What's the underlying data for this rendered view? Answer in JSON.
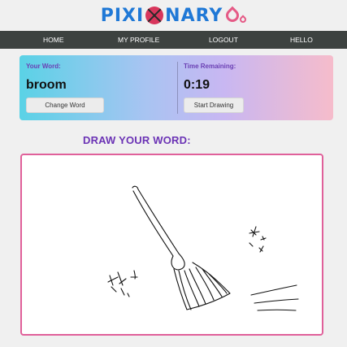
{
  "brand": {
    "name_left": "PIXI",
    "name_right": "NARY"
  },
  "nav": {
    "items": [
      {
        "label": "HOME"
      },
      {
        "label": "MY PROFILE"
      },
      {
        "label": "LOGOUT"
      },
      {
        "label": "HELLO"
      }
    ]
  },
  "word_panel": {
    "word_label": "Your Word:",
    "word": "broom",
    "change_button": "Change Word",
    "time_label": "Time Remaining:",
    "time": "0:19",
    "start_button": "Start Drawing"
  },
  "canvas": {
    "heading": "DRAW YOUR WORD:",
    "border_color": "#e0609a",
    "content": "hand-drawn broom sketch"
  },
  "colors": {
    "brand_blue": "#1f78d6",
    "accent_pink": "#e55a86",
    "heading_purple": "#6b33b5",
    "navbar": "#3d4240"
  }
}
